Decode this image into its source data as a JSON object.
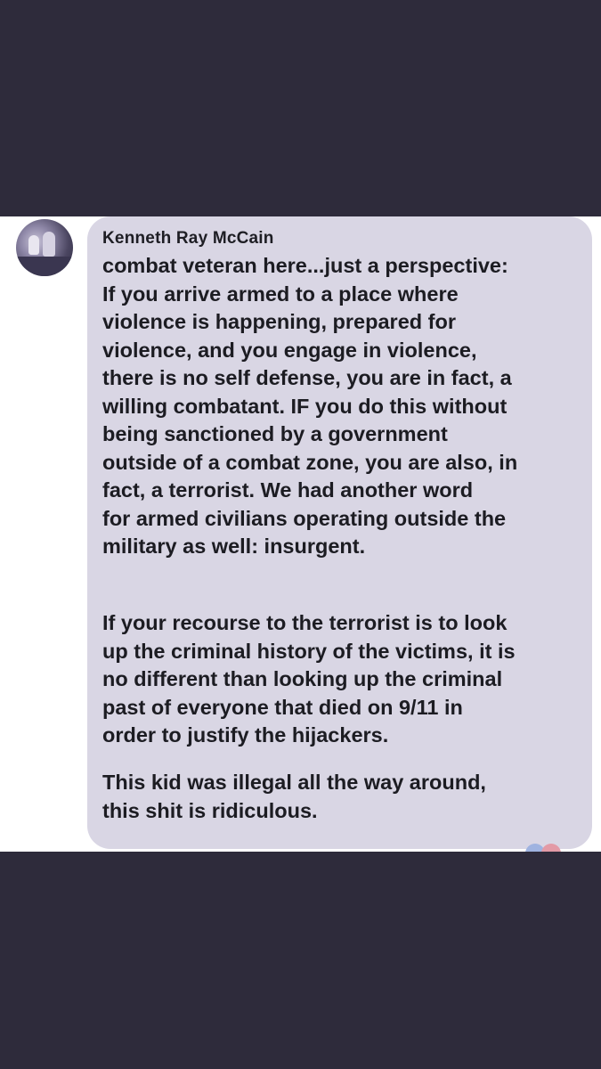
{
  "comment": {
    "author": "Kenneth Ray McCain",
    "paragraphs": [
      {
        "lines": [
          "combat veteran here...just a perspective:",
          "If you arrive armed to a place where",
          "violence is happening, prepared for",
          "violence, and you engage in violence,",
          "there is no self defense, you are in fact, a",
          "willing combatant.  IF you do this without",
          "being sanctioned by a government",
          "outside of a combat zone, you are also, in",
          "fact, a terrorist.  We had another word",
          "for armed civilians operating outside the",
          "military as well:  insurgent."
        ]
      },
      {
        "lines": [
          "If your recourse to the terrorist is to look",
          "up the criminal history of the victims, it is",
          "no different than looking up the criminal",
          "past of everyone that died on 9/11 in",
          "order to justify the hijackers."
        ]
      },
      {
        "lines": [
          "This kid was illegal all the way around,",
          "this shit is ridiculous."
        ]
      }
    ],
    "reactions": [
      "like-icon",
      "love-icon"
    ]
  },
  "colors": {
    "page_background": "#2e2b3b",
    "bubble_background": "#d9d6e4",
    "text": "#1c1c22"
  }
}
